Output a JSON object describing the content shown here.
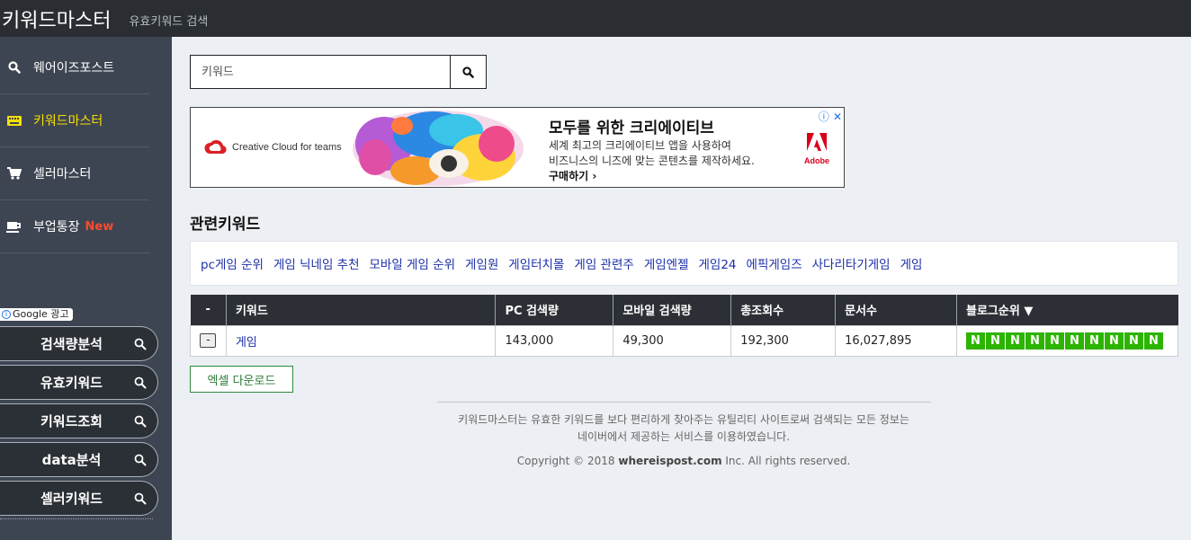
{
  "header": {
    "brand": "키워드마스터",
    "subtitle": "유효키워드 검색"
  },
  "sidebar": {
    "nav": [
      {
        "label": "웨어이즈포스트",
        "icon": "search-icon"
      },
      {
        "label": "키워드마스터",
        "icon": "keyboard-icon",
        "active": true
      },
      {
        "label": "셀러마스터",
        "icon": "cart-icon"
      },
      {
        "label": "부업통장",
        "icon": "coffee-cup-icon",
        "badge": "New"
      }
    ],
    "ad_badge": "Google 광고",
    "pills": [
      {
        "label": "검색량분석"
      },
      {
        "label": "유효키워드"
      },
      {
        "label": "키워드조회"
      },
      {
        "label": "data분석"
      },
      {
        "label": "셀러키워드"
      }
    ]
  },
  "search": {
    "placeholder": "키워드",
    "value": ""
  },
  "ad": {
    "brand_text": "Creative Cloud for teams",
    "title": "모두를 위한 크리에이티브",
    "body_line1": "세계 최고의 크리에이티브 앱을 사용하여",
    "body_line2": "비즈니스의 니즈에 맞는 콘텐츠를 제작하세요.",
    "cta": "구매하기 ›",
    "logo_text": "Adobe"
  },
  "related": {
    "title": "관련키워드",
    "keywords": [
      "pc게임 순위",
      "게임 닉네임 추천",
      "모바일 게임 순위",
      "게임원",
      "게임터치몰",
      "게임 관련주",
      "게임엔젤",
      "게임24",
      "에픽게임즈",
      "사다리타기게임",
      "게임"
    ]
  },
  "table": {
    "headers": [
      "-",
      "키워드",
      "PC 검색량",
      "모바일 검색량",
      "총조회수",
      "문서수",
      "블로그순위 ▼"
    ],
    "rows": [
      {
        "btn": "-",
        "keyword": "게임",
        "pc": "143,000",
        "mobile": "49,300",
        "total": "192,300",
        "docs": "16,027,895",
        "blog_ranks": [
          "N",
          "N",
          "N",
          "N",
          "N",
          "N",
          "N",
          "N",
          "N",
          "N"
        ]
      }
    ]
  },
  "excel_label": "엑셀 다운로드",
  "footer": {
    "line1": "키워드마스터는 유효한 키워드를 보다 편리하게 찾아주는 유틸리티 사이트로써 검색되는 모든 정보는",
    "line2": "네이버에서 제공하는 서비스를 이용하였습니다.",
    "copy_prefix": "Copyright © 2018 ",
    "copy_site": "whereispost.com",
    "copy_suffix": " Inc. All rights reserved."
  },
  "colors": {
    "topbar": "#2a2e33",
    "sidebar": "#3e4552",
    "accent_yellow": "#f7e000",
    "naver_green": "#2db400",
    "link_blue": "#1c2fa8"
  }
}
